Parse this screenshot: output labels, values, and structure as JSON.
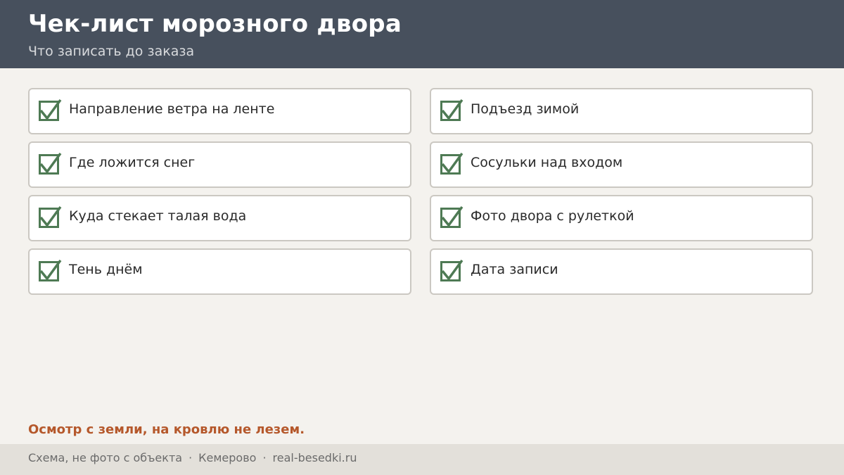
{
  "header": {
    "title": "Чек-лист морозного двора",
    "subtitle": "Что записать до заказа"
  },
  "checklist": {
    "items": [
      {
        "label": "Направление ветра на ленте",
        "checked": true
      },
      {
        "label": "Подъезд зимой",
        "checked": true
      },
      {
        "label": "Где ложится снег",
        "checked": true
      },
      {
        "label": "Сосульки над входом",
        "checked": true
      },
      {
        "label": "Куда стекает талая вода",
        "checked": true
      },
      {
        "label": "Фото двора с рулеткой",
        "checked": true
      },
      {
        "label": "Тень днём",
        "checked": true
      },
      {
        "label": "Дата записи",
        "checked": true
      }
    ]
  },
  "notice": "Осмотр с земли, на кровлю не лезем.",
  "footer": {
    "note": "Схема, не фото с объекта",
    "separator": "·",
    "city": "Кемерово",
    "site": "real-besedki.ru"
  },
  "colors": {
    "header_bg": "#47505d",
    "check_green": "#4e7a54",
    "notice_orange": "#b5582b",
    "page_bg": "#f4f2ee",
    "footer_bg": "#e3e0da"
  },
  "icons": {
    "checkbox": "checkmark-icon"
  }
}
